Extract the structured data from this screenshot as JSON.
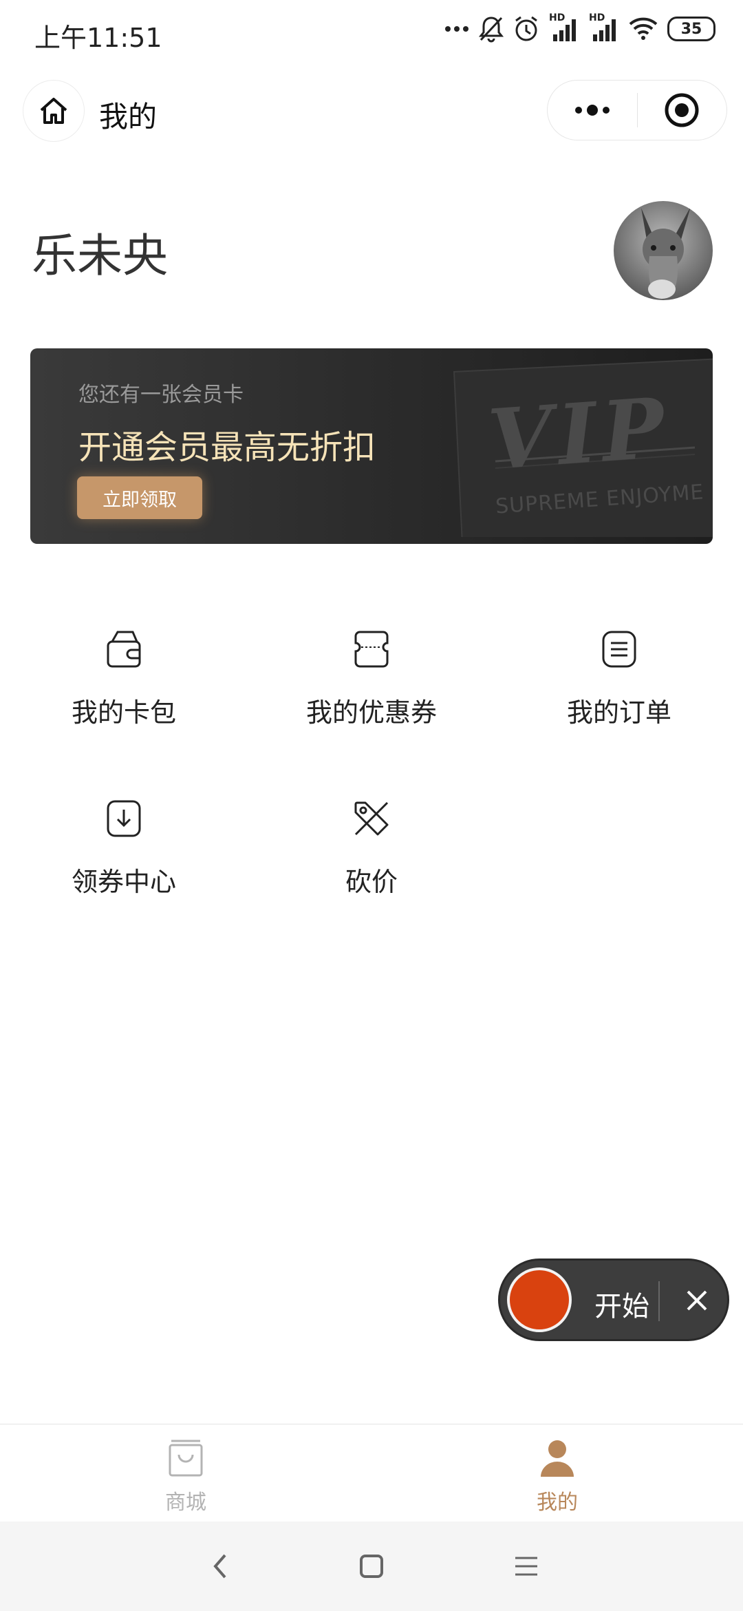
{
  "status_bar": {
    "time": "上午11:51",
    "signal_1_label": "HD",
    "signal_2_label": "HD",
    "battery": "35",
    "icons": [
      "more-dots-icon",
      "mute-bell-icon",
      "alarm-icon",
      "signal-icon",
      "signal-icon",
      "wifi-icon",
      "battery-icon"
    ]
  },
  "nav": {
    "title": "我的",
    "home_icon": "home-icon",
    "more_icon": "more-dots-icon",
    "close_icon": "target-circle-icon"
  },
  "profile": {
    "name": "乐未央",
    "avatar_icon": "donkey-avatar"
  },
  "vip_banner": {
    "subtitle": "您还有一张会员卡",
    "title": "开通会员最高无折扣",
    "button": "立即领取",
    "card_text": "VIP",
    "card_subtext": "SUPREME ENJOYME"
  },
  "menu": {
    "items": [
      {
        "label": "我的卡包",
        "icon": "wallet-icon"
      },
      {
        "label": "我的优惠券",
        "icon": "coupon-icon"
      },
      {
        "label": "我的订单",
        "icon": "order-list-icon"
      },
      {
        "label": "领券中心",
        "icon": "download-coupon-icon"
      },
      {
        "label": "砍价",
        "icon": "price-tag-icon"
      }
    ]
  },
  "floating_recorder": {
    "label": "开始",
    "close_icon": "close-icon",
    "accent": "#d9420f"
  },
  "tab_bar": {
    "tabs": [
      {
        "label": "商城",
        "icon": "shopping-bag-icon",
        "active": false
      },
      {
        "label": "我的",
        "icon": "user-icon",
        "active": true
      }
    ],
    "active_color": "#b8875a",
    "inactive_color": "#b3b3b3"
  },
  "system_nav": {
    "icons": [
      "back-icon",
      "home-square-icon",
      "menu-icon"
    ]
  }
}
